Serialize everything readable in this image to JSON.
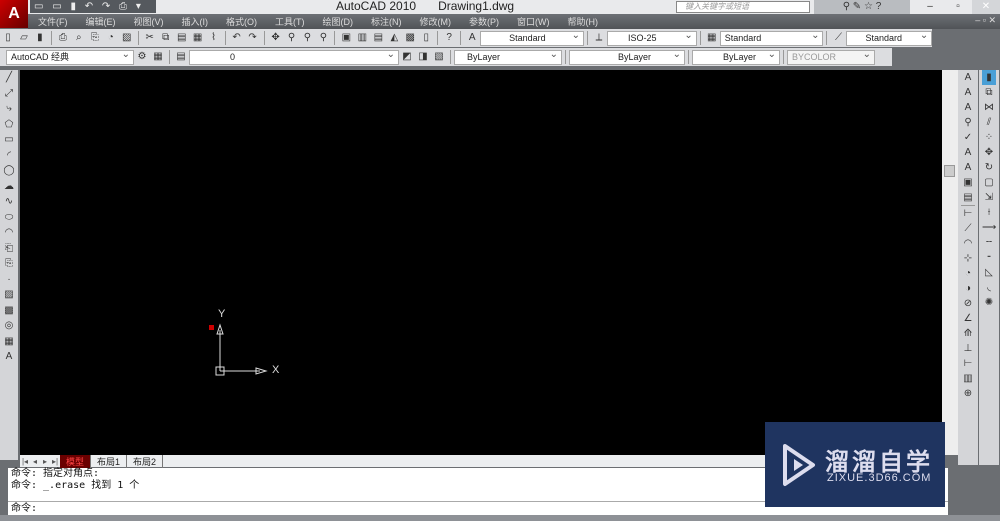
{
  "title": {
    "app": "AutoCAD 2010",
    "file": "Drawing1.dwg"
  },
  "search": {
    "placeholder": "键入关键字或短语"
  },
  "menu": [
    "文件(F)",
    "编辑(E)",
    "视图(V)",
    "插入(I)",
    "格式(O)",
    "工具(T)",
    "绘图(D)",
    "标注(N)",
    "修改(M)",
    "参数(P)",
    "窗口(W)",
    "帮助(H)"
  ],
  "styles": {
    "text_style": "Standard",
    "dim_style": "ISO-25",
    "table_style": "Standard",
    "mleader_style": "Standard"
  },
  "workspace": "AutoCAD 经典",
  "layer": "0",
  "properties": {
    "color": "ByLayer",
    "linetype": "ByLayer",
    "lineweight": "ByLayer",
    "plotstyle": "BYCOLOR"
  },
  "ucs": {
    "x": "X",
    "y": "Y"
  },
  "layout_tabs": [
    "模型",
    "布局1",
    "布局2"
  ],
  "command": {
    "lines": [
      "命令: 指定对角点:",
      "命令: _.erase 找到 1 个"
    ],
    "prompt": "命令:"
  },
  "watermark": {
    "name": "溜溜自学",
    "url": "ZIXUE.3D66.COM"
  },
  "colors": {
    "canvas": "#000000",
    "menubar": "#505357",
    "watermark": "#1f3460"
  }
}
